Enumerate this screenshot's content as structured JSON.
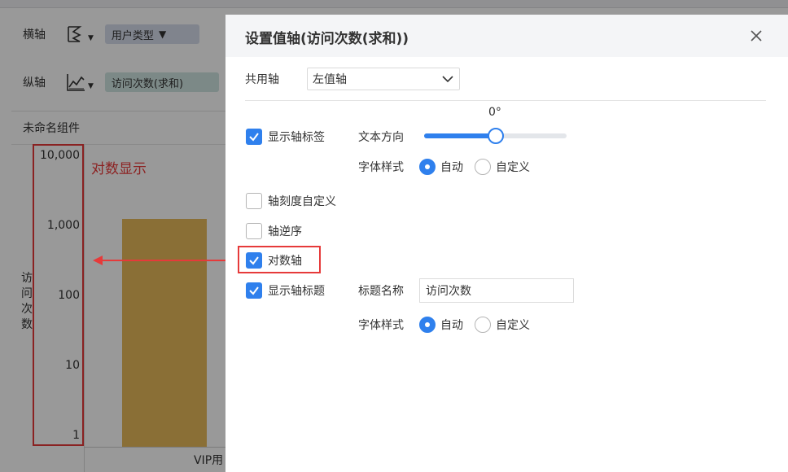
{
  "background": {
    "x_axis_label": "横轴",
    "y_axis_label": "纵轴",
    "x_field": "用户类型",
    "y_field": "访问次数(求和)",
    "component_title": "未命名组件",
    "annotation": "对数显示",
    "chart_data": {
      "type": "bar",
      "categories": [
        "VIP用"
      ],
      "values": [
        1300
      ],
      "ylabel": "访问次数",
      "yscale": "log",
      "ylim": [
        1,
        10000
      ],
      "ticks": [
        "10,000",
        "1,000",
        "100",
        "10",
        "1"
      ]
    },
    "colors": {
      "bar": "#e6b95a",
      "x_pill": "#d6dcec",
      "y_pill": "#cfe4e1",
      "annotation": "#ea3a3a"
    }
  },
  "dialog": {
    "title": "设置值轴(访问次数(求和))",
    "shared_axis": {
      "label": "共用轴",
      "value": "左值轴"
    },
    "show_axis_label": {
      "label": "显示轴标签",
      "checked": true
    },
    "text_direction": {
      "label": "文本方向",
      "value": "0°",
      "level": 0.5
    },
    "label_font_style": {
      "label": "字体样式",
      "options": [
        "自动",
        "自定义"
      ],
      "selected": "自动"
    },
    "custom_scale": {
      "label": "轴刻度自定义",
      "checked": false
    },
    "reverse_axis": {
      "label": "轴逆序",
      "checked": false
    },
    "log_axis": {
      "label": "对数轴",
      "checked": true
    },
    "show_axis_title": {
      "label": "显示轴标题",
      "checked": true
    },
    "title_name": {
      "label": "标题名称",
      "value": "访问次数"
    },
    "title_font_style": {
      "label": "字体样式",
      "options": [
        "自动",
        "自定义"
      ],
      "selected": "自动"
    },
    "accent": "#2f80ed"
  }
}
